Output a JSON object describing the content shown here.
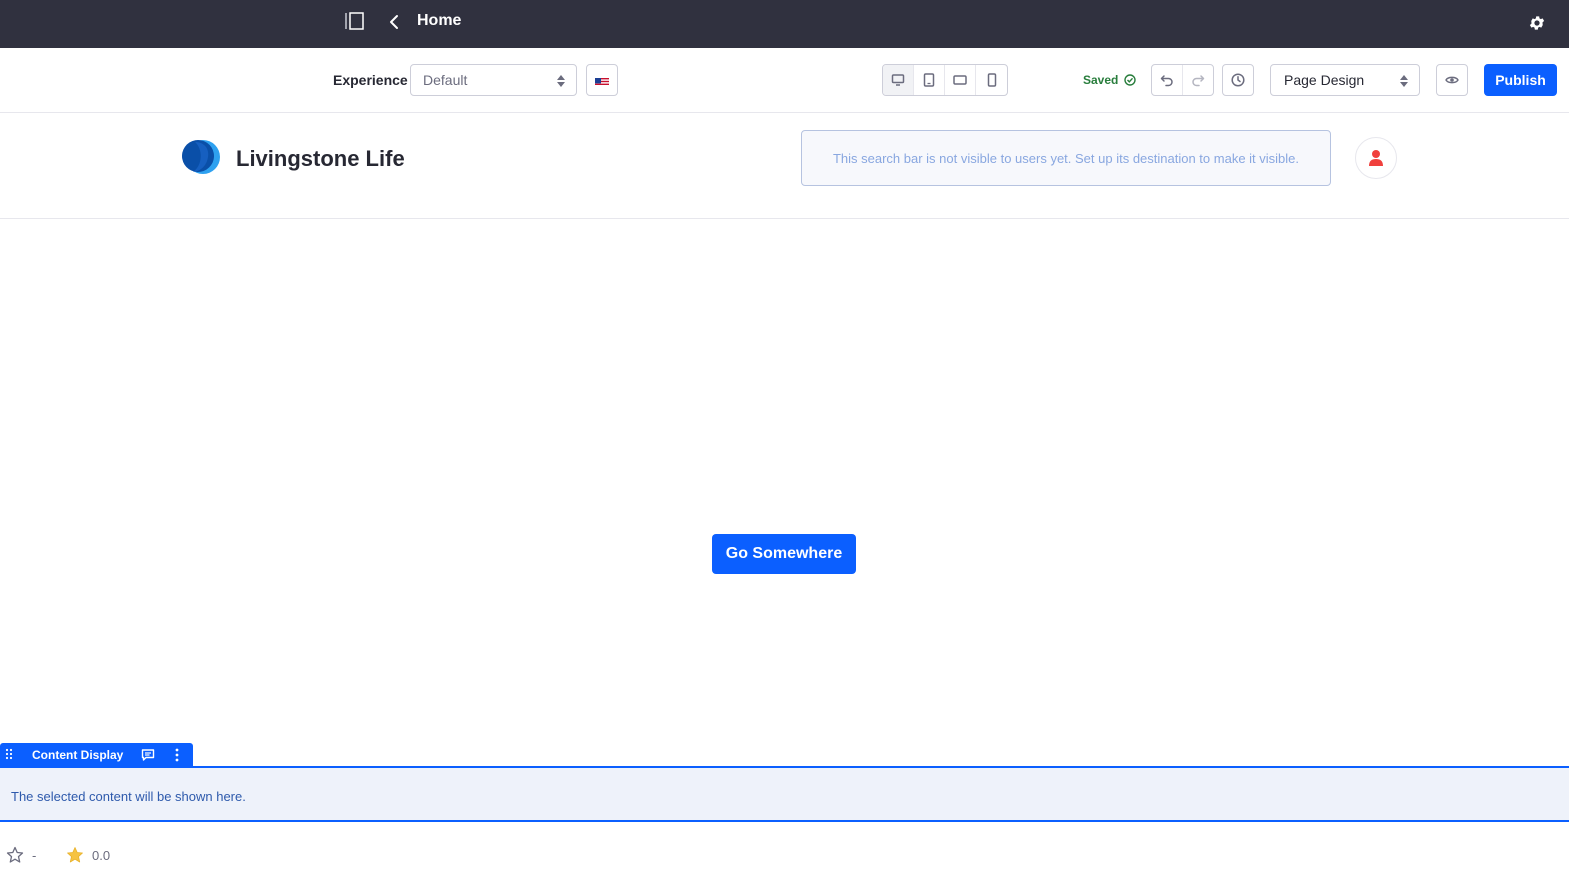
{
  "topbar": {
    "page_title": "Home",
    "icons": {
      "sidebar": "sidebar-panel-icon",
      "back": "chevron-left-icon",
      "settings": "gear-icon"
    }
  },
  "toolbar": {
    "experience_label": "Experience",
    "experience_value": "Default",
    "language_flag": "en-US",
    "devices": [
      "desktop",
      "tablet",
      "landscape-phone",
      "portrait-phone"
    ],
    "saved_label": "Saved",
    "mode_value": "Page Design",
    "publish_label": "Publish"
  },
  "site": {
    "name": "Livingstone Life",
    "search_notice": "This search bar is not visible to users yet. Set up its destination to make it visible."
  },
  "main": {
    "button_label": "Go Somewhere"
  },
  "fragment": {
    "label": "Content Display",
    "placeholder": "The selected content will be shown here."
  },
  "ratings": {
    "thumb_value": "-",
    "star_value": "0.0"
  },
  "colors": {
    "topbar": "#30313f",
    "primary": "#0b5fff",
    "saved": "#287d3c",
    "avatar": "#f0403d",
    "star": "#f6c342"
  }
}
